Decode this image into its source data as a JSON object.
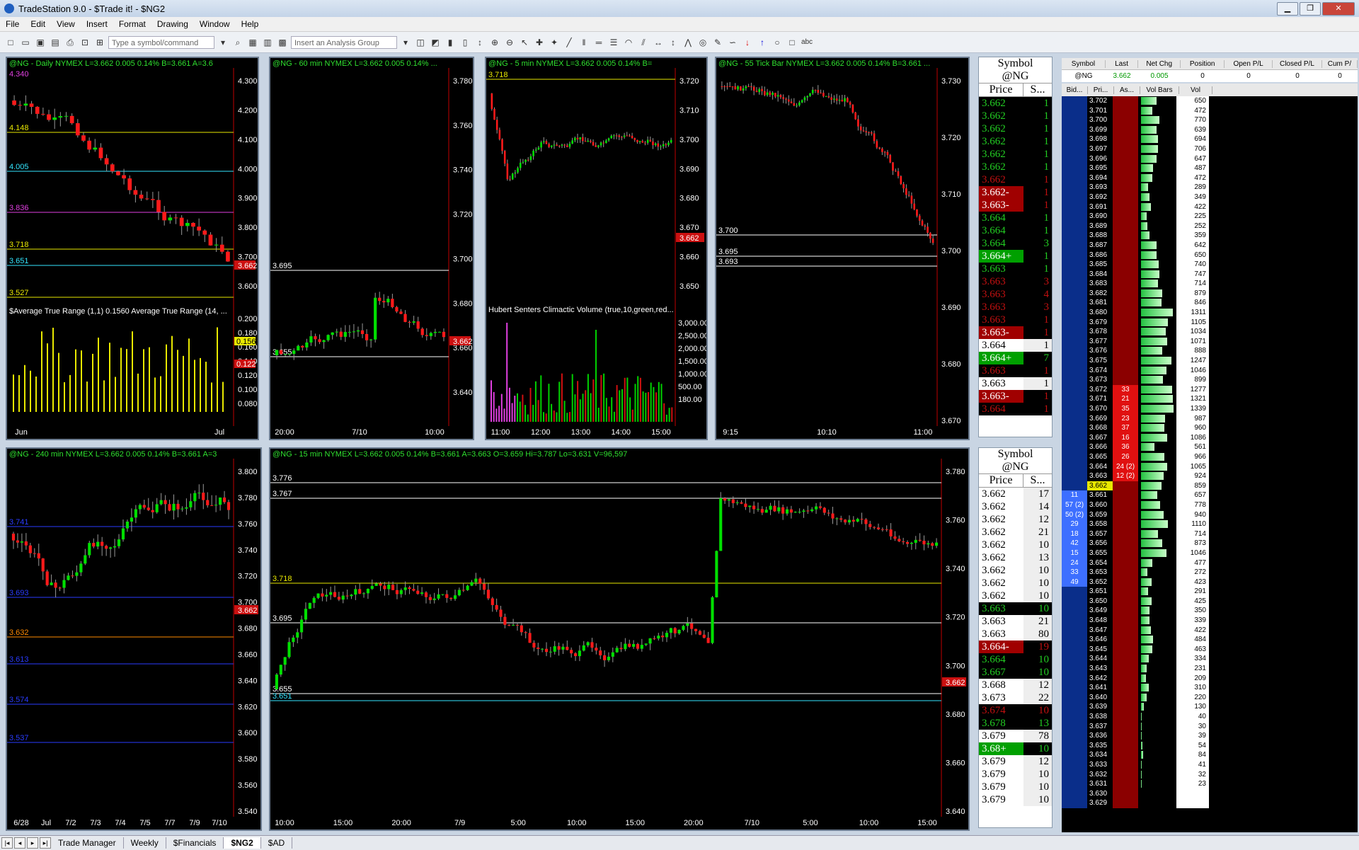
{
  "app": {
    "title": "TradeStation 9.0 - $Trade it! - $NG2"
  },
  "window_buttons": {
    "min": "▁",
    "max": "❐",
    "close": "✕"
  },
  "menu": [
    "File",
    "Edit",
    "View",
    "Insert",
    "Format",
    "Drawing",
    "Window",
    "Help"
  ],
  "toolbar": {
    "symbol_placeholder": "Type a symbol/command",
    "analysis_placeholder": "Insert an Analysis Group"
  },
  "charts": {
    "c1": {
      "header": "@NG - Daily  NYMEX  L=3.662  0.005   0.14%    B=3.661  A=3.6",
      "axis": [
        "4.300",
        "4.200",
        "4.100",
        "4.000",
        "3.900",
        "3.800",
        "3.700",
        "3.600"
      ],
      "lines": [
        "4.148",
        "4.005",
        "3.836",
        "3.718",
        "3.651",
        "3.527"
      ],
      "top_label": "4.340",
      "price_tag": "3.662",
      "ind1": "$Average True Range (1,1)   0.1560   Average True Range (14, ...",
      "ind_axis": [
        "0.200",
        "0.180",
        "0.160",
        "0.140",
        "0.120",
        "0.100",
        "0.080"
      ],
      "ind_tags": [
        "0.156",
        "0.122"
      ],
      "xaxis": [
        "Jun",
        "Jul"
      ]
    },
    "c2": {
      "header": "@NG - 60 min  NYMEX  L=3.662  0.005   0.14%   ...",
      "axis": [
        "3.780",
        "3.760",
        "3.740",
        "3.720",
        "3.700",
        "3.680",
        "3.660",
        "3.640"
      ],
      "lines": [
        "3.695",
        "3.655"
      ],
      "price_tag": "3.662",
      "xaxis": [
        "20:00",
        "7/10",
        "10:00"
      ]
    },
    "c3": {
      "header": "@NG - 5 min  NYMEX  L=3.662  0.005   0.14%   B=",
      "axis": [
        "3.720",
        "3.710",
        "3.700",
        "3.690",
        "3.680",
        "3.670",
        "3.660",
        "3.650"
      ],
      "lines": [
        "3.718"
      ],
      "price_tag": "3.662",
      "ind1": "Hubert Senters Climactic Volume (true,10,green,red...",
      "ind_axis": [
        "3,000.00",
        "2,500.00",
        "2,000.00",
        "1,500.00",
        "1,000.00",
        "500.00",
        "180.00"
      ],
      "xaxis": [
        "11:00",
        "12:00",
        "13:00",
        "14:00",
        "15:00"
      ]
    },
    "c4": {
      "header": "@NG - 55 Tick Bar  NYMEX  L=3.662  0.005   0.14%   B=3.661   ...",
      "axis": [
        "3.730",
        "3.720",
        "3.710",
        "3.700",
        "3.690",
        "3.680",
        "3.670"
      ],
      "lines": [
        "3.700",
        "3.695",
        "3.693"
      ],
      "xaxis": [
        "9:15",
        "10:10",
        "11:00"
      ]
    },
    "c5": {
      "header": "@NG - 240 min  NYMEX  L=3.662  0.005   0.14%    B=3.661  A=3",
      "axis": [
        "3.800",
        "3.780",
        "3.760",
        "3.740",
        "3.720",
        "3.700",
        "3.680",
        "3.660",
        "3.640",
        "3.620",
        "3.600",
        "3.580",
        "3.560",
        "3.540"
      ],
      "lines": [
        "3.741",
        "3.693",
        "3.632",
        "3.613",
        "3.574",
        "3.537"
      ],
      "price_tag": "3.662",
      "xaxis": [
        "6/28",
        "Jul",
        "7/2",
        "7/3",
        "7/4",
        "7/5",
        "7/7",
        "7/9",
        "7/10"
      ]
    },
    "c6": {
      "header": "@NG - 15 min  NYMEX  L=3.662  0.005   0.14%    B=3.661  A=3.663  O=3.659   Hi=3.787   Lo=3.631   V=96,597",
      "axis": [
        "3.780",
        "3.760",
        "3.740",
        "3.720",
        "3.700",
        "3.680",
        "3.660",
        "3.640"
      ],
      "lines": [
        "3.776",
        "3.767",
        "3.718",
        "3.695",
        "3.655",
        "3.651"
      ],
      "price_tag": "3.662",
      "xaxis": [
        "10:00",
        "15:00",
        "20:00",
        "7/9",
        "5:00",
        "10:00",
        "15:00",
        "20:00",
        "7/10",
        "5:00",
        "10:00",
        "15:00"
      ]
    }
  },
  "ts1": {
    "symbol_hdr": "Symbol",
    "symbol": "@NG",
    "col_price": "Price",
    "col_size": "S...",
    "rows": [
      [
        "3.662",
        "1",
        "g"
      ],
      [
        "3.662",
        "1",
        "g"
      ],
      [
        "3.662",
        "1",
        "g"
      ],
      [
        "3.662",
        "1",
        "g"
      ],
      [
        "3.662",
        "1",
        "g"
      ],
      [
        "3.662",
        "1",
        "g"
      ],
      [
        "3.662",
        "1",
        "r"
      ],
      [
        "3.662-",
        "1",
        "R"
      ],
      [
        "3.663-",
        "1",
        "R"
      ],
      [
        "3.664",
        "1",
        "g"
      ],
      [
        "3.664",
        "1",
        "g"
      ],
      [
        "3.664",
        "3",
        "g"
      ],
      [
        "3.664+",
        "1",
        "G"
      ],
      [
        "3.663",
        "1",
        "g"
      ],
      [
        "3.663",
        "3",
        "r"
      ],
      [
        "3.663",
        "4",
        "r"
      ],
      [
        "3.663",
        "3",
        "r"
      ],
      [
        "3.663",
        "1",
        "r"
      ],
      [
        "3.663-",
        "1",
        "R"
      ],
      [
        "3.664",
        "1",
        "w"
      ],
      [
        "3.664+",
        "7",
        "G"
      ],
      [
        "3.663",
        "1",
        "r"
      ],
      [
        "3.663",
        "1",
        "w"
      ],
      [
        "3.663-",
        "1",
        "R"
      ],
      [
        "3.664",
        "1",
        "r"
      ]
    ]
  },
  "ts2": {
    "symbol_hdr": "Symbol",
    "symbol": "@NG",
    "col_price": "Price",
    "col_size": "S...",
    "rows": [
      [
        "3.662",
        "17",
        "w"
      ],
      [
        "3.662",
        "14",
        "w"
      ],
      [
        "3.662",
        "12",
        "w"
      ],
      [
        "3.662",
        "21",
        "w"
      ],
      [
        "3.662",
        "10",
        "w"
      ],
      [
        "3.662",
        "13",
        "w"
      ],
      [
        "3.662",
        "10",
        "w"
      ],
      [
        "3.662",
        "10",
        "w"
      ],
      [
        "3.662",
        "10",
        "w"
      ],
      [
        "3.663",
        "10",
        "g"
      ],
      [
        "3.663",
        "21",
        "w"
      ],
      [
        "3.663",
        "80",
        "w"
      ],
      [
        "3.664-",
        "19",
        "R"
      ],
      [
        "3.664",
        "10",
        "g"
      ],
      [
        "3.667",
        "10",
        "g"
      ],
      [
        "3.668",
        "12",
        "w"
      ],
      [
        "3.673",
        "22",
        "w"
      ],
      [
        "3.674",
        "10",
        "r"
      ],
      [
        "3.678",
        "13",
        "g"
      ],
      [
        "3.679",
        "78",
        "w"
      ],
      [
        "3.68+",
        "10",
        "G"
      ],
      [
        "3.679",
        "12",
        "w"
      ],
      [
        "3.679",
        "10",
        "w"
      ],
      [
        "3.679",
        "10",
        "w"
      ],
      [
        "3.679",
        "10",
        "w"
      ]
    ]
  },
  "quote": {
    "headers": [
      "Symbol",
      "Last",
      "Net Chg",
      "Position",
      "Open P/L",
      "Closed P/L",
      "Cum P/"
    ],
    "row": [
      "@NG",
      "3.662",
      "0.005",
      "0",
      "0",
      "0",
      "0"
    ]
  },
  "dom": {
    "headers": [
      "Bid...",
      "Pri...",
      "As...",
      "Vol Bars",
      "Vol"
    ],
    "rows": [
      [
        "",
        "3.702",
        "",
        "650"
      ],
      [
        "",
        "3.701",
        "",
        "472"
      ],
      [
        "",
        "3.700",
        "",
        "770"
      ],
      [
        "",
        "3.699",
        "",
        "639"
      ],
      [
        "",
        "3.698",
        "",
        "694"
      ],
      [
        "",
        "3.697",
        "",
        "706"
      ],
      [
        "",
        "3.696",
        "",
        "647"
      ],
      [
        "",
        "3.695",
        "",
        "487"
      ],
      [
        "",
        "3.694",
        "",
        "472"
      ],
      [
        "",
        "3.693",
        "",
        "289"
      ],
      [
        "",
        "3.692",
        "",
        "349"
      ],
      [
        "",
        "3.691",
        "",
        "422"
      ],
      [
        "",
        "3.690",
        "",
        "225"
      ],
      [
        "",
        "3.689",
        "",
        "252"
      ],
      [
        "",
        "3.688",
        "",
        "359"
      ],
      [
        "",
        "3.687",
        "",
        "642"
      ],
      [
        "",
        "3.686",
        "",
        "650"
      ],
      [
        "",
        "3.685",
        "",
        "740"
      ],
      [
        "",
        "3.684",
        "",
        "747"
      ],
      [
        "",
        "3.683",
        "",
        "714"
      ],
      [
        "",
        "3.682",
        "",
        "879"
      ],
      [
        "",
        "3.681",
        "",
        "846"
      ],
      [
        "",
        "3.680",
        "",
        "1311"
      ],
      [
        "",
        "3.679",
        "",
        "1105"
      ],
      [
        "",
        "3.678",
        "",
        "1034"
      ],
      [
        "",
        "3.677",
        "",
        "1071"
      ],
      [
        "",
        "3.676",
        "",
        "888"
      ],
      [
        "",
        "3.675",
        "",
        "1247"
      ],
      [
        "",
        "3.674",
        "",
        "1046"
      ],
      [
        "",
        "3.673",
        "",
        "899"
      ],
      [
        "",
        "3.672",
        "33",
        "1277"
      ],
      [
        "",
        "3.671",
        "21",
        "1321"
      ],
      [
        "",
        "3.670",
        "35",
        "1339"
      ],
      [
        "",
        "3.669",
        "23",
        "987"
      ],
      [
        "",
        "3.668",
        "37",
        "960"
      ],
      [
        "",
        "3.667",
        "16",
        "1086"
      ],
      [
        "",
        "3.666",
        "36",
        "561"
      ],
      [
        "",
        "3.665",
        "26",
        "966"
      ],
      [
        "",
        "3.664",
        "24 (2)",
        "1065"
      ],
      [
        "",
        "3.663",
        "12 (2)",
        "924"
      ],
      [
        "",
        "3.662",
        "",
        "859"
      ],
      [
        "11",
        "3.661",
        "",
        "657"
      ],
      [
        "57 (2)",
        "3.660",
        "",
        "778"
      ],
      [
        "50 (2)",
        "3.659",
        "",
        "940"
      ],
      [
        "29",
        "3.658",
        "",
        "1110"
      ],
      [
        "18",
        "3.657",
        "",
        "714"
      ],
      [
        "42",
        "3.656",
        "",
        "873"
      ],
      [
        "15",
        "3.655",
        "",
        "1046"
      ],
      [
        "24",
        "3.654",
        "",
        "477"
      ],
      [
        "33",
        "3.653",
        "",
        "272"
      ],
      [
        "49",
        "3.652",
        "",
        "423"
      ],
      [
        "",
        "3.651",
        "",
        "291"
      ],
      [
        "",
        "3.650",
        "",
        "425"
      ],
      [
        "",
        "3.649",
        "",
        "350"
      ],
      [
        "",
        "3.648",
        "",
        "339"
      ],
      [
        "",
        "3.647",
        "",
        "422"
      ],
      [
        "",
        "3.646",
        "",
        "484"
      ],
      [
        "",
        "3.645",
        "",
        "463"
      ],
      [
        "",
        "3.644",
        "",
        "334"
      ],
      [
        "",
        "3.643",
        "",
        "231"
      ],
      [
        "",
        "3.642",
        "",
        "209"
      ],
      [
        "",
        "3.641",
        "",
        "310"
      ],
      [
        "",
        "3.640",
        "",
        "220"
      ],
      [
        "",
        "3.639",
        "",
        "130"
      ],
      [
        "",
        "3.638",
        "",
        "40"
      ],
      [
        "",
        "3.637",
        "",
        "30"
      ],
      [
        "",
        "3.636",
        "",
        "39"
      ],
      [
        "",
        "3.635",
        "",
        "54"
      ],
      [
        "",
        "3.634",
        "",
        "84"
      ],
      [
        "",
        "3.633",
        "",
        "41"
      ],
      [
        "",
        "3.632",
        "",
        "32"
      ],
      [
        "",
        "3.631",
        "",
        "23"
      ],
      [
        "",
        "3.630",
        "",
        ""
      ],
      [
        "",
        "3.629",
        "",
        ""
      ]
    ]
  },
  "tabs": [
    "Trade Manager",
    "Weekly",
    "$Financials",
    "$NG2",
    "$AD"
  ],
  "active_tab": "$NG2",
  "colors": {
    "bull": "#00e000",
    "bear": "#ff1a1a",
    "cyan": "#33e6ff",
    "magenta": "#e040e0",
    "yellow": "#e8e800"
  }
}
